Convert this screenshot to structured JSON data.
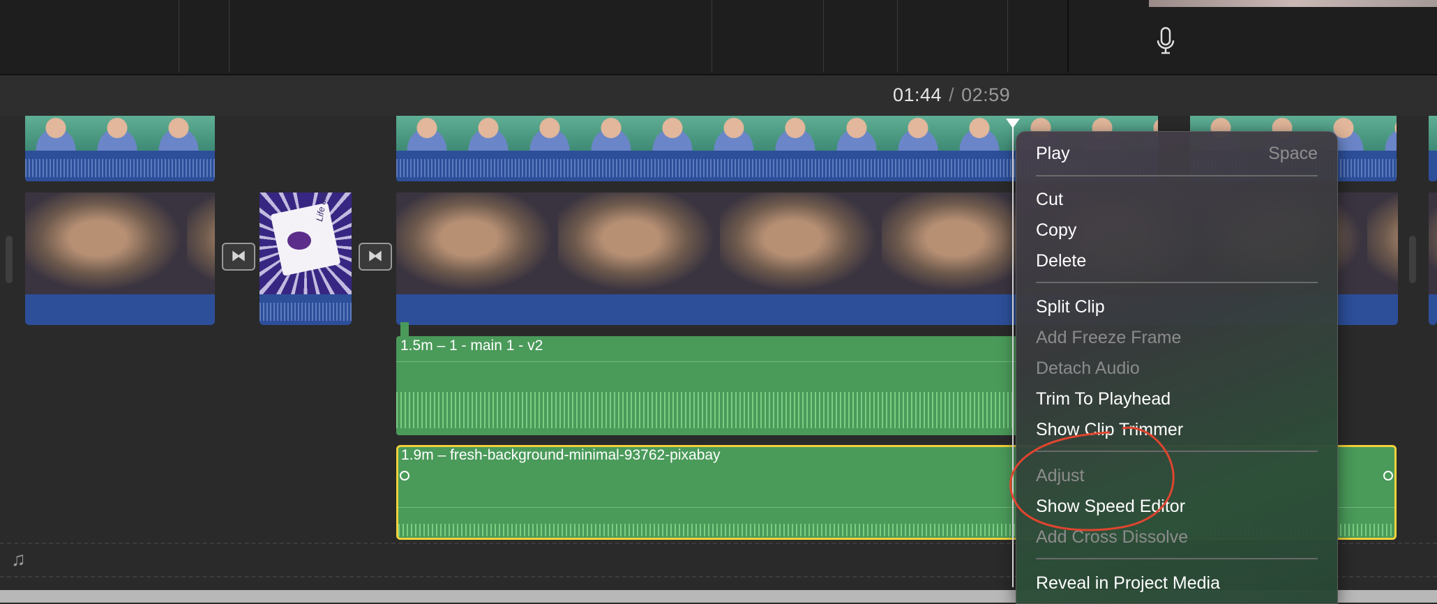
{
  "timecode": {
    "current": "01:44",
    "separator": "/",
    "duration": "02:59"
  },
  "toolbar": {
    "mic_icon": "microphone-icon"
  },
  "timeline": {
    "transition_icon": "⧓",
    "title_card_text": "Life unblocking",
    "audio_tracks": [
      {
        "label": "1.5m – 1 - main 1 - v2"
      },
      {
        "label": "1.9m – fresh-background-minimal-93762-pixabay"
      }
    ],
    "music_well_icon": "♫"
  },
  "context_menu": {
    "items": [
      {
        "label": "Play",
        "shortcut": "Space",
        "enabled": true
      },
      {
        "label": "Cut",
        "enabled": true
      },
      {
        "label": "Copy",
        "enabled": true
      },
      {
        "label": "Delete",
        "enabled": true
      },
      {
        "label": "Split Clip",
        "enabled": true
      },
      {
        "label": "Add Freeze Frame",
        "enabled": false
      },
      {
        "label": "Detach Audio",
        "enabled": false
      },
      {
        "label": "Trim To Playhead",
        "enabled": true
      },
      {
        "label": "Show Clip Trimmer",
        "enabled": true
      },
      {
        "label": "Adjust",
        "enabled": false
      },
      {
        "label": "Show Speed Editor",
        "enabled": true
      },
      {
        "label": "Add Cross Dissolve",
        "enabled": false
      },
      {
        "label": "Reveal in Project Media",
        "enabled": true
      }
    ]
  },
  "colors": {
    "selection_outline": "#f1d23c",
    "audio_green": "#4a9a5a",
    "clip_audio_blue": "#2d4f9a",
    "annotation_red": "#e0452f"
  }
}
